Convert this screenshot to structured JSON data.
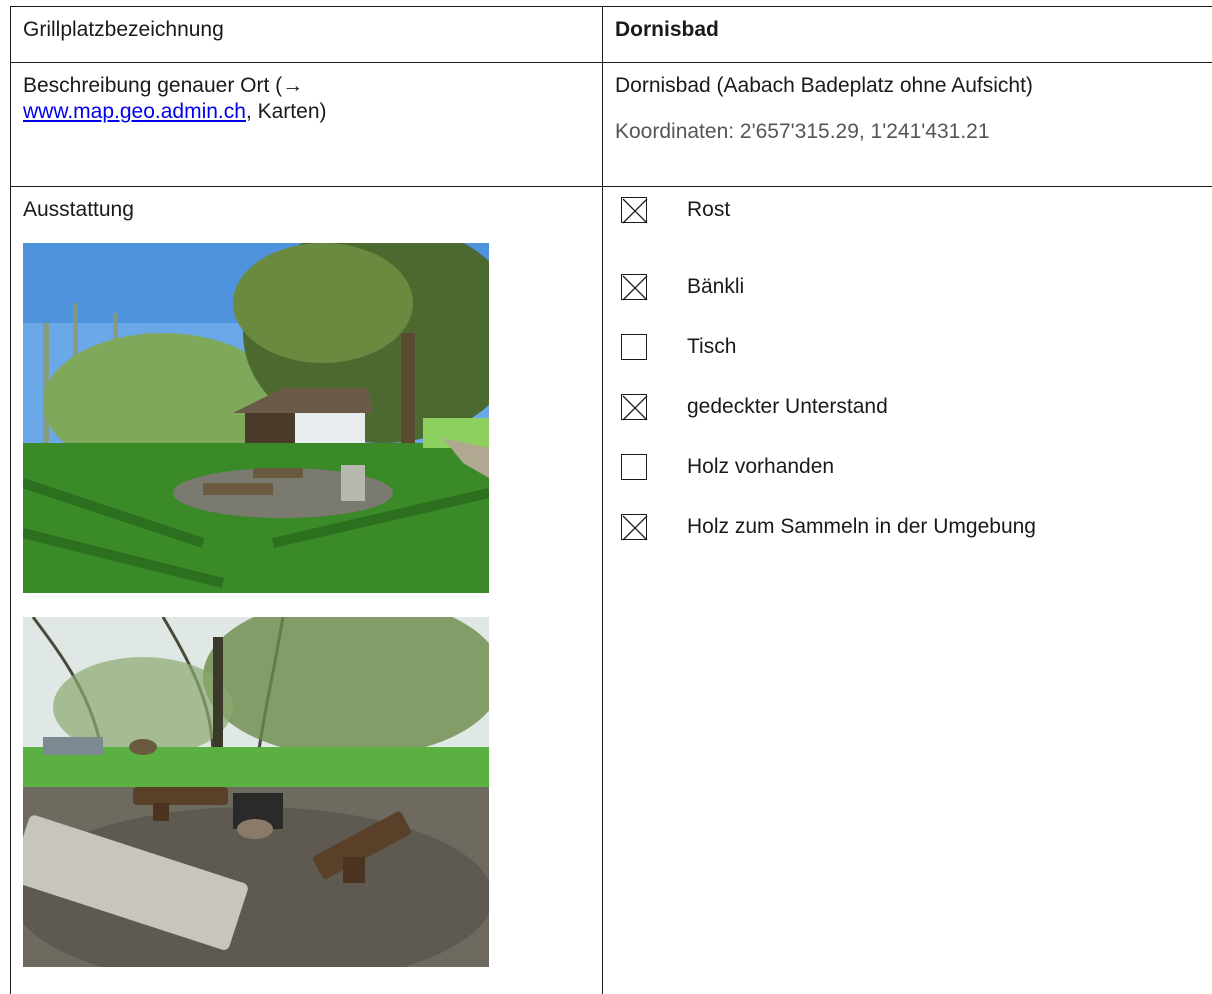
{
  "row_name": {
    "label": "Grillplatzbezeichnung",
    "value": "Dornisbad"
  },
  "row_location": {
    "label_prefix": "Beschreibung genauer Ort (→",
    "link_text": "www.map.geo.admin.ch",
    "label_suffix": ", Karten)",
    "value": "Dornisbad (Aabach Badeplatz ohne Aufsicht)",
    "coordinates": "Koordinaten: 2'657'315.29, 1'241'431.21"
  },
  "row_equipment": {
    "label": "Ausstattung",
    "items": [
      {
        "label": "Rost",
        "checked": true
      },
      {
        "label": "Bänkli",
        "checked": true
      },
      {
        "label": "Tisch",
        "checked": false
      },
      {
        "label": "gedeckter Unterstand",
        "checked": true
      },
      {
        "label": "Holz vorhanden",
        "checked": false
      },
      {
        "label": "Holz zum Sammeln in der Umgebung",
        "checked": true
      }
    ]
  },
  "colors": {
    "link": "#0000ee",
    "text": "#1a1a1a",
    "muted": "#555555"
  }
}
